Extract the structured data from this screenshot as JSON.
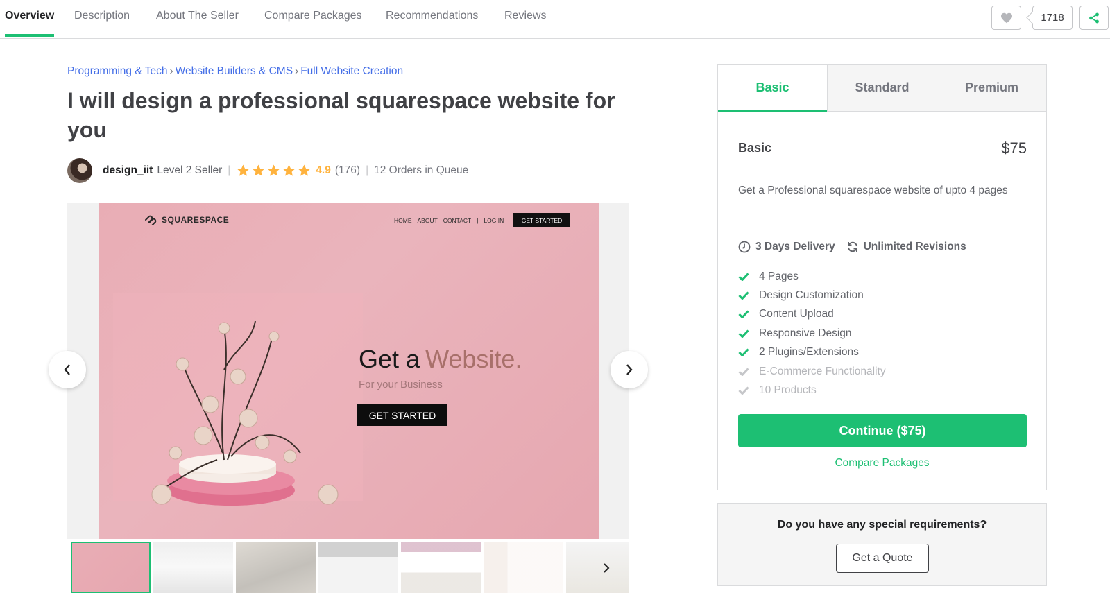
{
  "nav": {
    "tabs": [
      "Overview",
      "Description",
      "About The Seller",
      "Compare Packages",
      "Recommendations",
      "Reviews"
    ],
    "active_tab": "Overview",
    "save_count": "1718"
  },
  "breadcrumb": [
    "Programming & Tech",
    "Website Builders & CMS",
    "Full Website Creation"
  ],
  "title": "I will design a professional squarespace website for you",
  "seller": {
    "name": "design_iit",
    "level": "Level 2 Seller",
    "rating": "4.9",
    "reviews": "(176)",
    "queue": "12 Orders in Queue"
  },
  "gallery": {
    "brand": "SQUARESPACE",
    "nav_links": [
      "HOME",
      "ABOUT",
      "CONTACT",
      "|",
      "LOG IN"
    ],
    "nav_cta": "GET STARTED",
    "headline_1": "Get a",
    "headline_2": "Website.",
    "subline": "For your Business",
    "cta": "GET STARTED"
  },
  "package": {
    "tabs": [
      "Basic",
      "Standard",
      "Premium"
    ],
    "active_tab": "Basic",
    "name": "Basic",
    "price": "$75",
    "description": "Get a Professional squarespace website of upto 4 pages",
    "delivery": "3 Days Delivery",
    "revisions": "Unlimited Revisions",
    "features": [
      {
        "label": "4 Pages",
        "included": true
      },
      {
        "label": "Design Customization",
        "included": true
      },
      {
        "label": "Content Upload",
        "included": true
      },
      {
        "label": "Responsive Design",
        "included": true
      },
      {
        "label": "2 Plugins/Extensions",
        "included": true
      },
      {
        "label": "E-Commerce Functionality",
        "included": false
      },
      {
        "label": "10 Products",
        "included": false
      }
    ],
    "continue_label": "Continue ($75)",
    "compare_label": "Compare Packages"
  },
  "quote": {
    "question": "Do you have any special requirements?",
    "button": "Get a Quote"
  },
  "colors": {
    "accent": "#1dbf73",
    "link": "#446ee7",
    "star": "#ffb33e"
  }
}
